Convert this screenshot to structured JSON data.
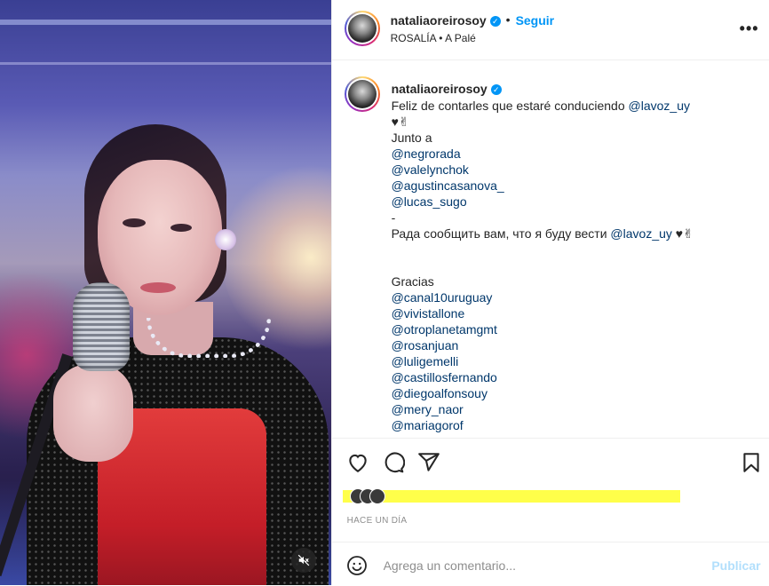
{
  "post": {
    "username": "nataliaoreirosoy",
    "follow_label": "Seguir",
    "dot": "•",
    "audio": "ROSALÍA • A Palé",
    "more_label": "•••"
  },
  "caption": {
    "username": "nataliaoreirosoy",
    "line1": "Feliz de contarles que estaré conduciendo ",
    "mention1": "@lavoz_uy",
    "line2": "♥✌",
    "line3": "Junto a",
    "mentions_a": [
      "@negrorada",
      "@valelynchok",
      "@agustincasanova_",
      "@lucas_sugo"
    ],
    "dash": "-",
    "ru_line": "Рада сообщить вам, что я буду вести ",
    "ru_mention": "@lavoz_uy",
    "ru_tail": " ♥✌",
    "gracias": "Gracias",
    "mentions_b": [
      "@canal10uruguay",
      "@vivistallone",
      "@otroplanetamgmt",
      "@rosanjuan",
      "@luligemelli",
      "@castillosfernando",
      "@diegoalfonsouy",
      "@mery_naor",
      "@mariagorof"
    ]
  },
  "actions": {
    "time": "HACE UN DÍA"
  },
  "comment_box": {
    "placeholder": "Agrega un comentario...",
    "publish_label": "Publicar"
  },
  "colors": {
    "accent": "#0095f6",
    "highlight": "#ffff4a",
    "mention": "#00376b"
  }
}
